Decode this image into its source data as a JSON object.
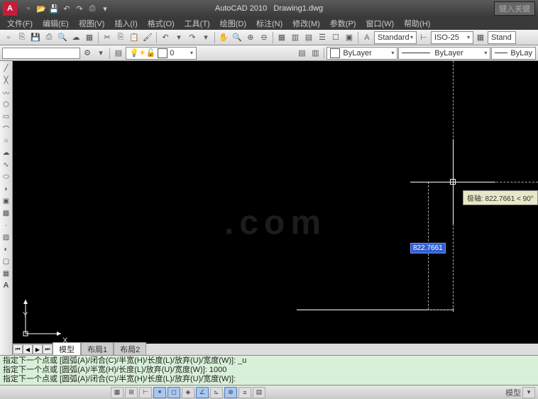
{
  "title": {
    "app": "AutoCAD 2010",
    "doc": "Drawing1.dwg",
    "search": "键入关键"
  },
  "menu": [
    "文件(F)",
    "编辑(E)",
    "视图(V)",
    "插入(I)",
    "格式(O)",
    "工具(T)",
    "绘图(D)",
    "标注(N)",
    "修改(M)",
    "参数(P)",
    "窗口(W)",
    "帮助(H)"
  ],
  "styles": {
    "text": "Standard",
    "dim": "ISO-25",
    "table": "Stand"
  },
  "layer": {
    "name": "0",
    "bylayer1": "ByLayer",
    "bylayer2": "ByLayer",
    "bylayer3": "ByLay"
  },
  "tabs": {
    "model": "模型",
    "layout1": "布局1",
    "layout2": "布局2"
  },
  "ucs": {
    "x": "X",
    "y": "Y"
  },
  "dim_value": "822.7661",
  "tooltip": "极轴: 822.7661 < 90°",
  "cmd": {
    "l1": "指定下一个点或 [圆弧(A)/闭合(C)/半宽(H)/长度(L)/放弃(U)/宽度(W)]: _u",
    "l2": "指定下一个点或 [圆弧(A)/半宽(H)/长度(L)/放弃(U)/宽度(W)]: 1000",
    "l3": "指定下一个点或 [圆弧(A)/闭合(C)/半宽(H)/长度(L)/放弃(U)/宽度(W)]:"
  },
  "status": {
    "coords": "",
    "right": "模型"
  },
  "watermark": ".com"
}
